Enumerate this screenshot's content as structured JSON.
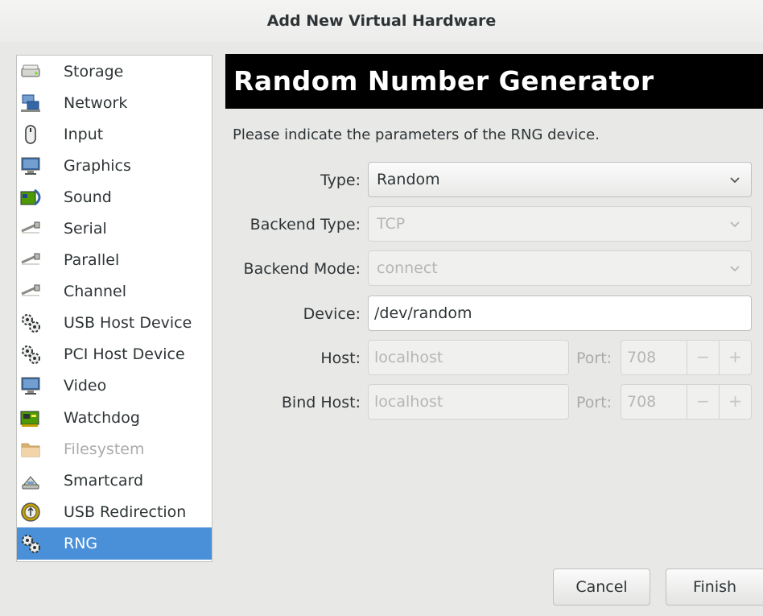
{
  "window": {
    "title": "Add New Virtual Hardware"
  },
  "sidebar": {
    "items": [
      {
        "label": "Storage",
        "icon": "storage-icon",
        "state": "normal"
      },
      {
        "label": "Network",
        "icon": "network-icon",
        "state": "normal"
      },
      {
        "label": "Input",
        "icon": "mouse-icon",
        "state": "normal"
      },
      {
        "label": "Graphics",
        "icon": "monitor-icon",
        "state": "normal"
      },
      {
        "label": "Sound",
        "icon": "sound-card-icon",
        "state": "normal"
      },
      {
        "label": "Serial",
        "icon": "serial-cable-icon",
        "state": "normal"
      },
      {
        "label": "Parallel",
        "icon": "parallel-cable-icon",
        "state": "normal"
      },
      {
        "label": "Channel",
        "icon": "channel-cable-icon",
        "state": "normal"
      },
      {
        "label": "USB Host Device",
        "icon": "gears-icon",
        "state": "normal"
      },
      {
        "label": "PCI Host Device",
        "icon": "gears-icon",
        "state": "normal"
      },
      {
        "label": "Video",
        "icon": "monitor-icon",
        "state": "normal"
      },
      {
        "label": "Watchdog",
        "icon": "circuit-board-icon",
        "state": "normal"
      },
      {
        "label": "Filesystem",
        "icon": "folder-icon",
        "state": "disabled"
      },
      {
        "label": "Smartcard",
        "icon": "smartcard-icon",
        "state": "normal"
      },
      {
        "label": "USB Redirection",
        "icon": "usb-icon",
        "state": "normal"
      },
      {
        "label": "RNG",
        "icon": "gears-icon",
        "state": "selected"
      }
    ]
  },
  "main": {
    "heading": "Random Number Generator",
    "description": "Please indicate the parameters of the RNG device.",
    "type": {
      "label": "Type:",
      "value": "Random"
    },
    "backend_type": {
      "label": "Backend Type:",
      "value": "TCP"
    },
    "backend_mode": {
      "label": "Backend Mode:",
      "value": "connect"
    },
    "device": {
      "label": "Device:",
      "value": "/dev/random"
    },
    "host": {
      "label": "Host:",
      "value": "localhost",
      "port_label": "Port:",
      "port_value": "708"
    },
    "bind_host": {
      "label": "Bind Host:",
      "value": "localhost",
      "port_label": "Port:",
      "port_value": "708"
    },
    "spin_minus": "−",
    "spin_plus": "+"
  },
  "buttons": {
    "cancel": "Cancel",
    "finish": "Finish"
  },
  "colors": {
    "selection": "#4a90d9",
    "banner": "#000000",
    "dialog_bg": "#e8e8e7"
  }
}
